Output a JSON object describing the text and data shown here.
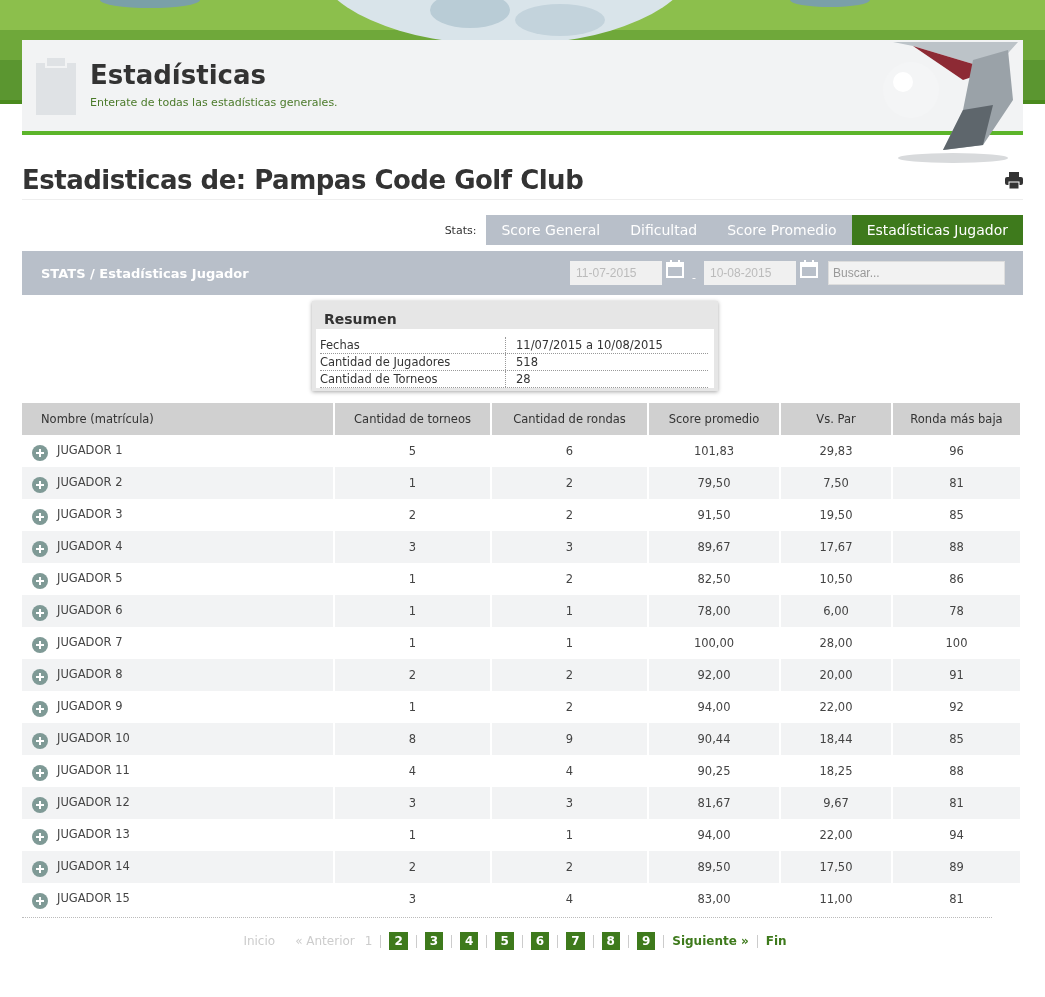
{
  "header": {
    "title": "Estadísticas",
    "subtitle": "Enterate de todas las estadísticas generales."
  },
  "page_title": "Estadisticas de: Pampas Code Golf Club",
  "tabs_label": "Stats:",
  "tabs": [
    {
      "label": "Score General",
      "selected": false
    },
    {
      "label": "Dificultad",
      "selected": false
    },
    {
      "label": "Score Promedio",
      "selected": false
    },
    {
      "label": "Estadísticas Jugador",
      "selected": true
    }
  ],
  "filter_bar": {
    "breadcrumb": "STATS / Estadísticas Jugador",
    "date_from": {
      "placeholder": "11-07-2015"
    },
    "separator": "-",
    "date_to": {
      "placeholder": "10-08-2015"
    },
    "search": {
      "placeholder": "Buscar..."
    }
  },
  "summary": {
    "title": "Resumen",
    "rows": [
      {
        "label": "Fechas",
        "value": "11/07/2015 a 10/08/2015"
      },
      {
        "label": "Cantidad de Jugadores",
        "value": "518"
      },
      {
        "label": "Cantidad de Torneos",
        "value": "28"
      }
    ]
  },
  "table": {
    "columns": [
      "Nombre (matrícula)",
      "Cantidad de torneos",
      "Cantidad de rondas",
      "Score promedio",
      "Vs. Par",
      "Ronda más baja"
    ],
    "rows": [
      [
        "JUGADOR 1",
        "5",
        "6",
        "101,83",
        "29,83",
        "96"
      ],
      [
        "JUGADOR 2",
        "1",
        "2",
        "79,50",
        "7,50",
        "81"
      ],
      [
        "JUGADOR 3",
        "2",
        "2",
        "91,50",
        "19,50",
        "85"
      ],
      [
        "JUGADOR 4",
        "3",
        "3",
        "89,67",
        "17,67",
        "88"
      ],
      [
        "JUGADOR 5",
        "1",
        "2",
        "82,50",
        "10,50",
        "86"
      ],
      [
        "JUGADOR 6",
        "1",
        "1",
        "78,00",
        "6,00",
        "78"
      ],
      [
        "JUGADOR 7",
        "1",
        "1",
        "100,00",
        "28,00",
        "100"
      ],
      [
        "JUGADOR 8",
        "2",
        "2",
        "92,00",
        "20,00",
        "91"
      ],
      [
        "JUGADOR 9",
        "1",
        "2",
        "94,00",
        "22,00",
        "92"
      ],
      [
        "JUGADOR 10",
        "8",
        "9",
        "90,44",
        "18,44",
        "85"
      ],
      [
        "JUGADOR 11",
        "4",
        "4",
        "90,25",
        "18,25",
        "88"
      ],
      [
        "JUGADOR 12",
        "3",
        "3",
        "81,67",
        "9,67",
        "81"
      ],
      [
        "JUGADOR 13",
        "1",
        "1",
        "94,00",
        "22,00",
        "94"
      ],
      [
        "JUGADOR 14",
        "2",
        "2",
        "89,50",
        "17,50",
        "89"
      ],
      [
        "JUGADOR 15",
        "3",
        "4",
        "83,00",
        "11,00",
        "81"
      ]
    ]
  },
  "pagination": {
    "first": {
      "label": "Inicio",
      "disabled": true
    },
    "previous": {
      "label": "« Anterior",
      "disabled": true
    },
    "pages": [
      {
        "label": "1",
        "selected": true
      },
      {
        "label": "2",
        "selected": false
      },
      {
        "label": "3",
        "selected": false
      },
      {
        "label": "4",
        "selected": false
      },
      {
        "label": "5",
        "selected": false
      },
      {
        "label": "6",
        "selected": false
      },
      {
        "label": "7",
        "selected": false
      },
      {
        "label": "8",
        "selected": false
      },
      {
        "label": "9",
        "selected": false
      }
    ],
    "next": {
      "label": "Siguiente »",
      "disabled": false
    },
    "last": {
      "label": "Fin",
      "disabled": false
    }
  }
}
